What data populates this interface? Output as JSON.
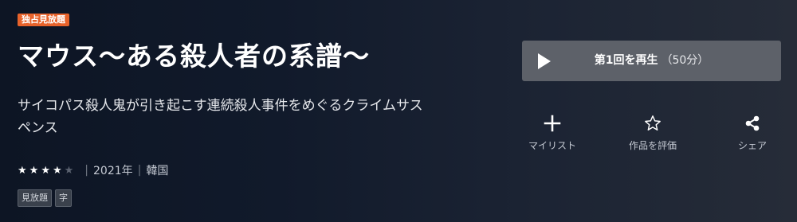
{
  "badge": "独占見放題",
  "title": "マウス～ある殺人者の系譜～",
  "description": "サイコパス殺人鬼が引き起こす連続殺人事件をめぐるクライムサスペンス",
  "rating": {
    "value": 4,
    "max": 5
  },
  "meta": {
    "year": "2021年",
    "country": "韓国"
  },
  "tags": [
    "見放題",
    "字"
  ],
  "play": {
    "label": "第1回を再生",
    "duration": "（50分）"
  },
  "actions": {
    "mylist": "マイリスト",
    "rate": "作品を評価",
    "share": "シェア"
  },
  "icons": [
    "play-icon",
    "plus-icon",
    "star-outline-icon",
    "share-icon"
  ],
  "colors": {
    "badge": "#e8632b",
    "play_button": "#5d6169"
  }
}
